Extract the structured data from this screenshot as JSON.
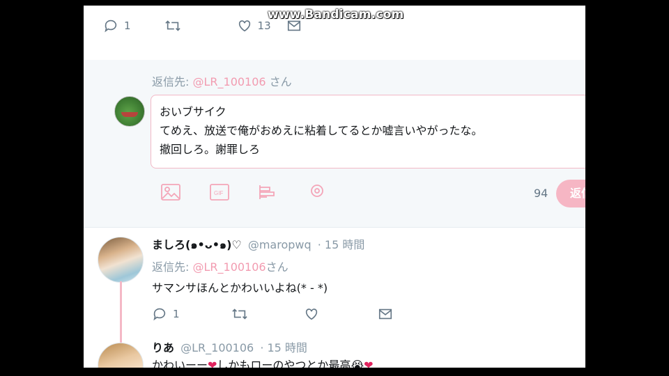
{
  "top_bar": {
    "reply_count": "1",
    "like_count": "13"
  },
  "watermark": "www.Bandicam.com",
  "compose": {
    "reply_to_prefix": "返信先: ",
    "reply_to_handle": "@LR_100106",
    "reply_to_suffix": " さん",
    "lines": [
      "おいブサイク",
      "てめえ、放送で俺がおめえに粘着してるとか嘘言いやがったな。",
      "撤回しろ。謝罪しろ"
    ],
    "char_count": "94",
    "tweet_button": "返信"
  },
  "tweets": [
    {
      "name": "ましろ(๑•ᴗ•๑)♡",
      "handle": "@maropwq",
      "time": "· 15 時間",
      "reply_to_prefix": "返信先: ",
      "reply_to_handle": "@LR_100106",
      "reply_to_suffix": "さん",
      "text": "サマンサほんとかわいいよね(* - *)",
      "reply_count": "1"
    },
    {
      "name": "りあ",
      "handle": "@LR_100106",
      "time": "· 15 時間",
      "text_a": "かわいーー",
      "text_b": "しかもローのやつとか最高",
      "emoji_face": "😭",
      "heart": "❤"
    }
  ],
  "colors": {
    "accent_pink": "#f29bb0",
    "border_pink": "#f2b8c6",
    "muted": "#8899a6"
  }
}
